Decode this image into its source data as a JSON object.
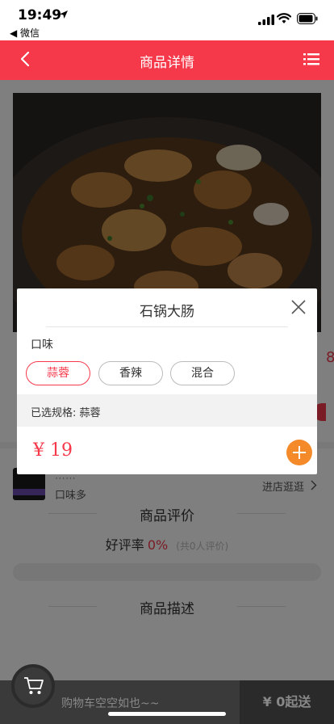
{
  "status_bar": {
    "time": "19:49",
    "back_app": "◀ 微信"
  },
  "nav": {
    "title": "商品详情"
  },
  "product": {
    "price_peek": "8"
  },
  "store": {
    "name": "⋯⋯",
    "subtitle": "口味多",
    "link": "进店逛逛"
  },
  "sections": {
    "reviews_title": "商品评价",
    "good_rate_label": "好评率",
    "good_rate_value": "0%",
    "review_count": "(共0人评价)",
    "description_title": "商品描述"
  },
  "dialog": {
    "title": "石锅大肠",
    "attr_label": "口味",
    "options": [
      "蒜蓉",
      "香辣",
      "混合"
    ],
    "selected_index": 0,
    "selected_text": "已选规格: 蒜蓉",
    "price": "¥ 19"
  },
  "cart": {
    "empty_text": "购物车空空如也~~",
    "checkout": "¥ 0起送"
  },
  "colors": {
    "brand_red": "#f5394b",
    "add_orange": "#f58a2a"
  }
}
